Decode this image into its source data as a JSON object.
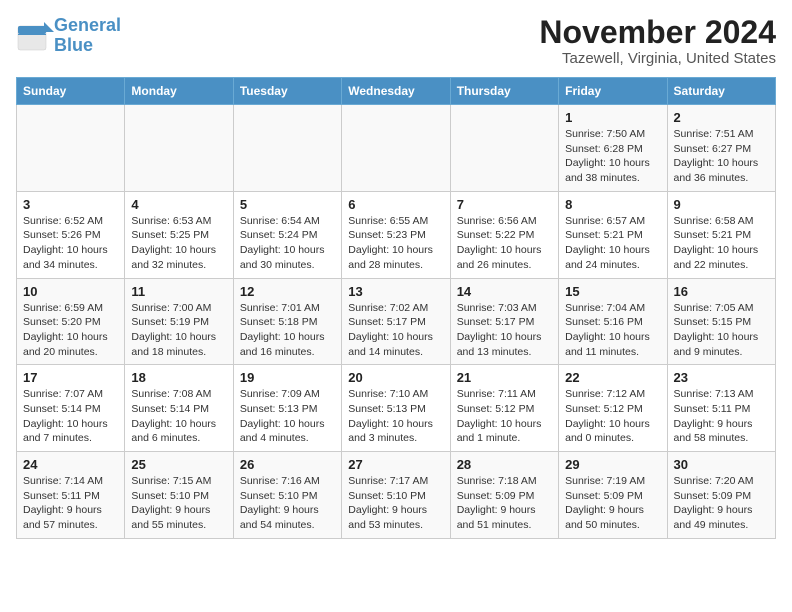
{
  "logo": {
    "line1": "General",
    "line2": "Blue"
  },
  "title": "November 2024",
  "location": "Tazewell, Virginia, United States",
  "weekdays": [
    "Sunday",
    "Monday",
    "Tuesday",
    "Wednesday",
    "Thursday",
    "Friday",
    "Saturday"
  ],
  "weeks": [
    [
      {
        "day": "",
        "info": ""
      },
      {
        "day": "",
        "info": ""
      },
      {
        "day": "",
        "info": ""
      },
      {
        "day": "",
        "info": ""
      },
      {
        "day": "",
        "info": ""
      },
      {
        "day": "1",
        "info": "Sunrise: 7:50 AM\nSunset: 6:28 PM\nDaylight: 10 hours\nand 38 minutes."
      },
      {
        "day": "2",
        "info": "Sunrise: 7:51 AM\nSunset: 6:27 PM\nDaylight: 10 hours\nand 36 minutes."
      }
    ],
    [
      {
        "day": "3",
        "info": "Sunrise: 6:52 AM\nSunset: 5:26 PM\nDaylight: 10 hours\nand 34 minutes."
      },
      {
        "day": "4",
        "info": "Sunrise: 6:53 AM\nSunset: 5:25 PM\nDaylight: 10 hours\nand 32 minutes."
      },
      {
        "day": "5",
        "info": "Sunrise: 6:54 AM\nSunset: 5:24 PM\nDaylight: 10 hours\nand 30 minutes."
      },
      {
        "day": "6",
        "info": "Sunrise: 6:55 AM\nSunset: 5:23 PM\nDaylight: 10 hours\nand 28 minutes."
      },
      {
        "day": "7",
        "info": "Sunrise: 6:56 AM\nSunset: 5:22 PM\nDaylight: 10 hours\nand 26 minutes."
      },
      {
        "day": "8",
        "info": "Sunrise: 6:57 AM\nSunset: 5:21 PM\nDaylight: 10 hours\nand 24 minutes."
      },
      {
        "day": "9",
        "info": "Sunrise: 6:58 AM\nSunset: 5:21 PM\nDaylight: 10 hours\nand 22 minutes."
      }
    ],
    [
      {
        "day": "10",
        "info": "Sunrise: 6:59 AM\nSunset: 5:20 PM\nDaylight: 10 hours\nand 20 minutes."
      },
      {
        "day": "11",
        "info": "Sunrise: 7:00 AM\nSunset: 5:19 PM\nDaylight: 10 hours\nand 18 minutes."
      },
      {
        "day": "12",
        "info": "Sunrise: 7:01 AM\nSunset: 5:18 PM\nDaylight: 10 hours\nand 16 minutes."
      },
      {
        "day": "13",
        "info": "Sunrise: 7:02 AM\nSunset: 5:17 PM\nDaylight: 10 hours\nand 14 minutes."
      },
      {
        "day": "14",
        "info": "Sunrise: 7:03 AM\nSunset: 5:17 PM\nDaylight: 10 hours\nand 13 minutes."
      },
      {
        "day": "15",
        "info": "Sunrise: 7:04 AM\nSunset: 5:16 PM\nDaylight: 10 hours\nand 11 minutes."
      },
      {
        "day": "16",
        "info": "Sunrise: 7:05 AM\nSunset: 5:15 PM\nDaylight: 10 hours\nand 9 minutes."
      }
    ],
    [
      {
        "day": "17",
        "info": "Sunrise: 7:07 AM\nSunset: 5:14 PM\nDaylight: 10 hours\nand 7 minutes."
      },
      {
        "day": "18",
        "info": "Sunrise: 7:08 AM\nSunset: 5:14 PM\nDaylight: 10 hours\nand 6 minutes."
      },
      {
        "day": "19",
        "info": "Sunrise: 7:09 AM\nSunset: 5:13 PM\nDaylight: 10 hours\nand 4 minutes."
      },
      {
        "day": "20",
        "info": "Sunrise: 7:10 AM\nSunset: 5:13 PM\nDaylight: 10 hours\nand 3 minutes."
      },
      {
        "day": "21",
        "info": "Sunrise: 7:11 AM\nSunset: 5:12 PM\nDaylight: 10 hours\nand 1 minute."
      },
      {
        "day": "22",
        "info": "Sunrise: 7:12 AM\nSunset: 5:12 PM\nDaylight: 10 hours\nand 0 minutes."
      },
      {
        "day": "23",
        "info": "Sunrise: 7:13 AM\nSunset: 5:11 PM\nDaylight: 9 hours\nand 58 minutes."
      }
    ],
    [
      {
        "day": "24",
        "info": "Sunrise: 7:14 AM\nSunset: 5:11 PM\nDaylight: 9 hours\nand 57 minutes."
      },
      {
        "day": "25",
        "info": "Sunrise: 7:15 AM\nSunset: 5:10 PM\nDaylight: 9 hours\nand 55 minutes."
      },
      {
        "day": "26",
        "info": "Sunrise: 7:16 AM\nSunset: 5:10 PM\nDaylight: 9 hours\nand 54 minutes."
      },
      {
        "day": "27",
        "info": "Sunrise: 7:17 AM\nSunset: 5:10 PM\nDaylight: 9 hours\nand 53 minutes."
      },
      {
        "day": "28",
        "info": "Sunrise: 7:18 AM\nSunset: 5:09 PM\nDaylight: 9 hours\nand 51 minutes."
      },
      {
        "day": "29",
        "info": "Sunrise: 7:19 AM\nSunset: 5:09 PM\nDaylight: 9 hours\nand 50 minutes."
      },
      {
        "day": "30",
        "info": "Sunrise: 7:20 AM\nSunset: 5:09 PM\nDaylight: 9 hours\nand 49 minutes."
      }
    ]
  ]
}
